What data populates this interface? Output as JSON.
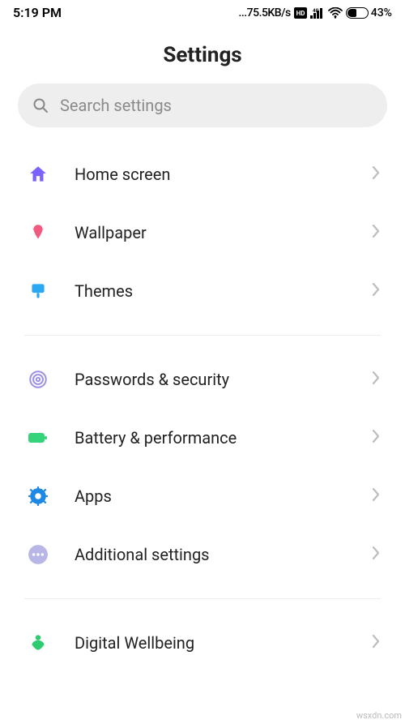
{
  "status": {
    "time": "5:19 PM",
    "net_speed": "...75.5KB/s",
    "battery_pct": "43%"
  },
  "title": "Settings",
  "search": {
    "placeholder": "Search settings"
  },
  "groups": [
    {
      "items": [
        {
          "id": "home-screen",
          "icon": "home-icon",
          "color": "#7b61ff",
          "label": "Home screen"
        },
        {
          "id": "wallpaper",
          "icon": "flower-icon",
          "color": "#f05a7e",
          "label": "Wallpaper"
        },
        {
          "id": "themes",
          "icon": "brush-icon",
          "color": "#2aa8f2",
          "label": "Themes"
        }
      ]
    },
    {
      "items": [
        {
          "id": "passwords-security",
          "icon": "fingerprint-icon",
          "color": "#9a8fe6",
          "label": "Passwords & security"
        },
        {
          "id": "battery-performance",
          "icon": "battery-icon",
          "color": "#35d47a",
          "label": "Battery & performance"
        },
        {
          "id": "apps",
          "icon": "gear-icon",
          "color": "#1e88e5",
          "label": "Apps"
        },
        {
          "id": "additional-settings",
          "icon": "dots-icon",
          "color": "#b8b6e6",
          "label": "Additional settings"
        }
      ]
    },
    {
      "items": [
        {
          "id": "digital-wellbeing",
          "icon": "wellbeing-icon",
          "color": "#2ecc71",
          "label": "Digital Wellbeing"
        }
      ]
    }
  ],
  "watermark": "wsxdn.com"
}
